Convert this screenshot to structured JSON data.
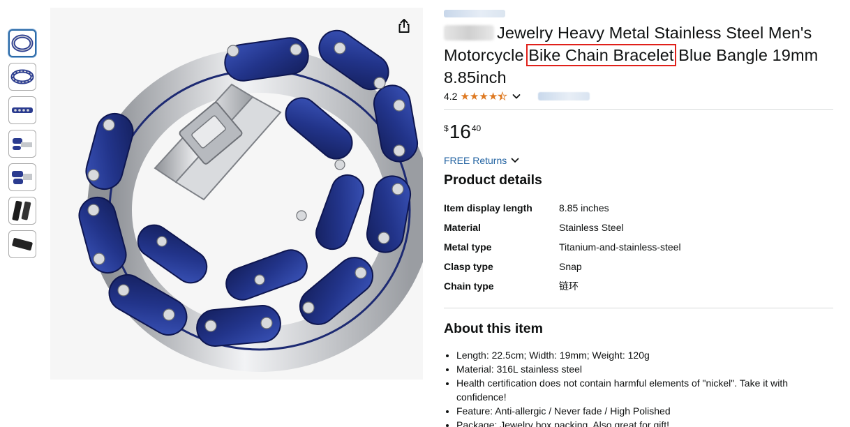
{
  "product": {
    "title_segments": {
      "pre": "Jewelry Heavy Metal Stainless Steel Men's Motorcycle ",
      "highlight": "Bike Chain Bracelet",
      "post": " Blue Bangle 19mm 8.85inch"
    },
    "rating": "4.2",
    "stars_filled": 4.2,
    "price": {
      "symbol": "$",
      "whole": "16",
      "fraction": "40"
    },
    "returns_label": "FREE Returns"
  },
  "details": {
    "heading": "Product details",
    "rows": [
      {
        "key": "Item display length",
        "value": "8.85 inches"
      },
      {
        "key": "Material",
        "value": "Stainless Steel"
      },
      {
        "key": "Metal type",
        "value": "Titanium-and-stainless-steel"
      },
      {
        "key": "Clasp type",
        "value": "Snap"
      },
      {
        "key": "Chain type",
        "value": "链环"
      }
    ]
  },
  "about": {
    "heading": "About this item",
    "bullets": [
      "Length: 22.5cm; Width: 19mm; Weight: 120g",
      "Material: 316L stainless steel",
      "Health certification does not contain harmful elements of \"nickel\". Take it with confidence!",
      "Feature: Anti-allergic / Never fade / High Polished",
      "Package: Jewelry box packing. Also great for gift!"
    ]
  },
  "colors": {
    "highlight_border": "#e0201a",
    "link": "#2162a1",
    "star": "#de7921",
    "chain_blue": "#26388f",
    "steel": "#c9cbcf"
  },
  "icons": [
    "share-icon",
    "star-icon",
    "chevron-down-icon"
  ]
}
